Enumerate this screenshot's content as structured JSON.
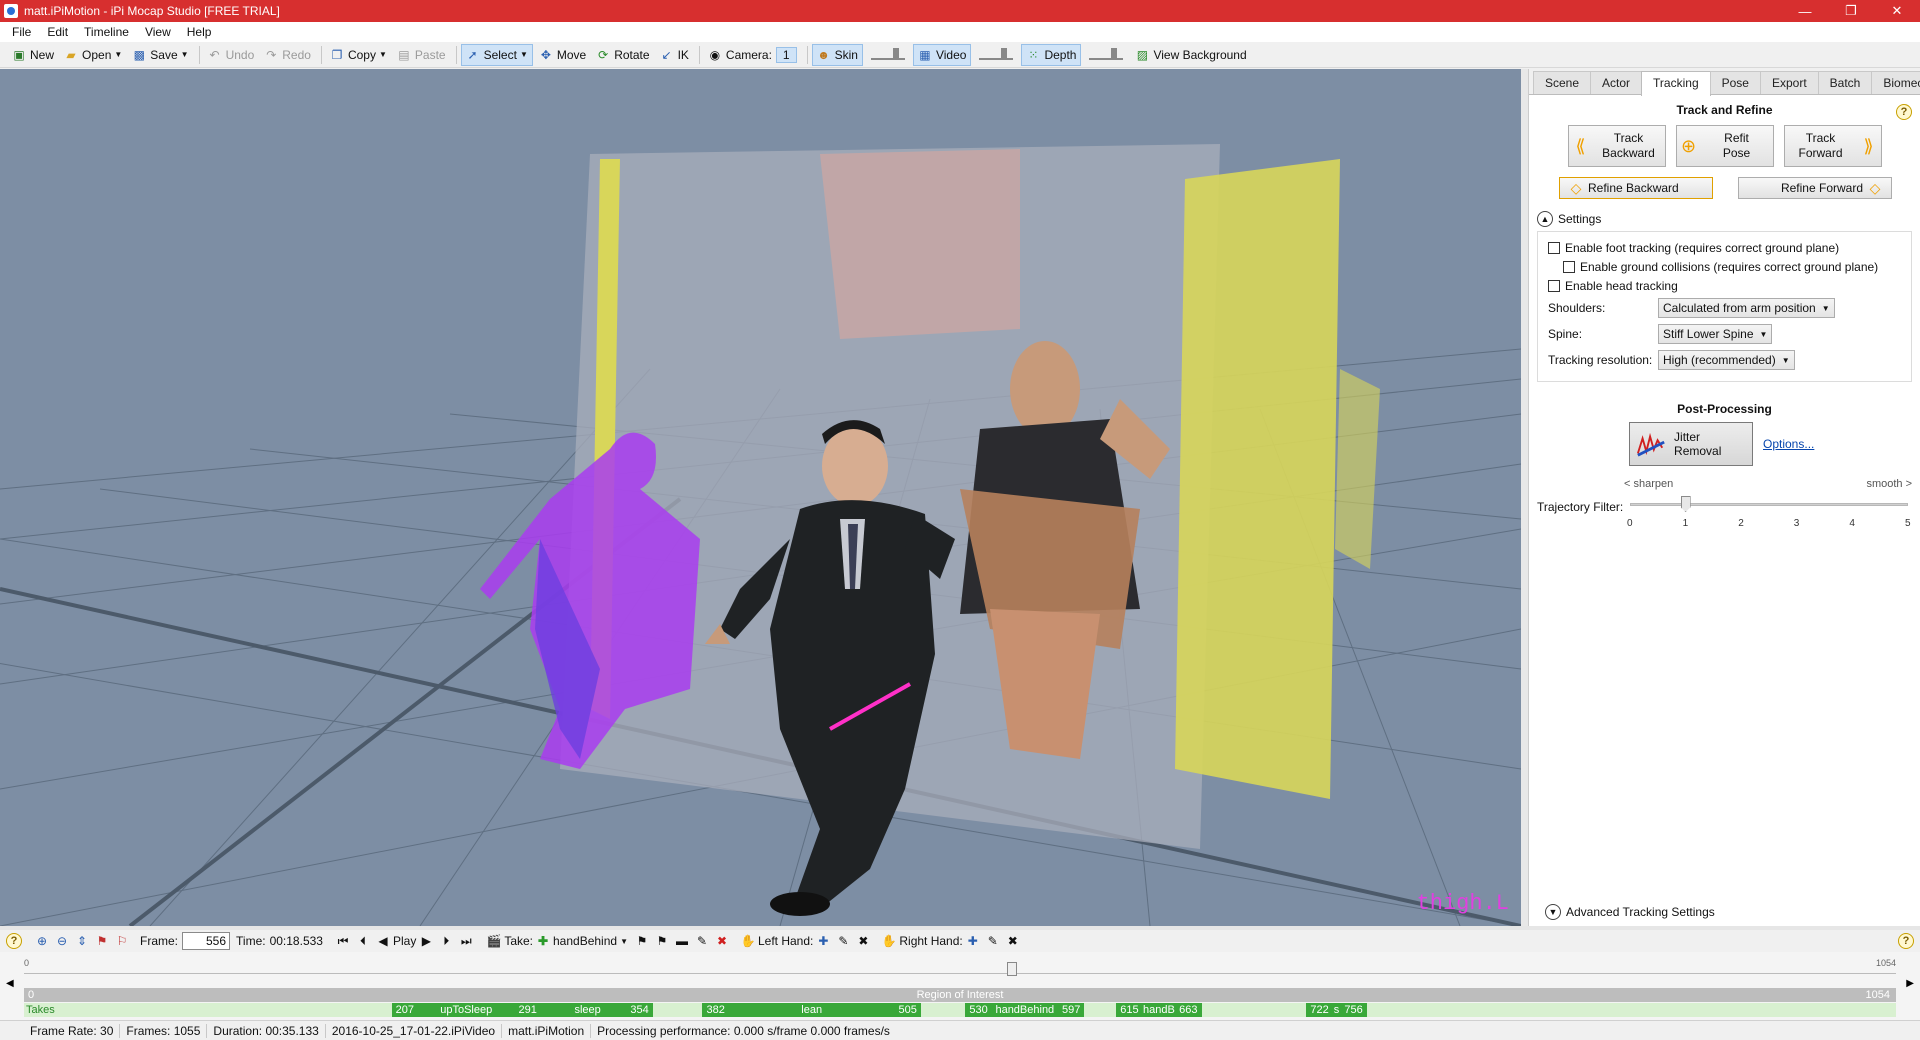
{
  "window": {
    "title": "matt.iPiMotion - iPi Mocap Studio [FREE TRIAL]",
    "minimize": "—",
    "maximize": "❐",
    "close": "✕"
  },
  "menu": [
    "File",
    "Edit",
    "Timeline",
    "View",
    "Help"
  ],
  "toolbar": {
    "new": "New",
    "open": "Open",
    "save": "Save",
    "undo": "Undo",
    "redo": "Redo",
    "copy": "Copy",
    "paste": "Paste",
    "select": "Select",
    "move": "Move",
    "rotate": "Rotate",
    "ik": "IK",
    "camera_label": "Camera:",
    "camera_value": "1",
    "skin": "Skin",
    "video": "Video",
    "depth": "Depth",
    "view_background": "View Background"
  },
  "viewport": {
    "bone_label": "thigh.L",
    "colors": {
      "background": "#7d8ea4",
      "grid": "#5f6f82",
      "backwall": "#9aa6b8",
      "yellow": "#d8d65a",
      "magenta": "#a93cf0"
    }
  },
  "panel": {
    "tabs": [
      "Scene",
      "Actor",
      "Tracking",
      "Pose",
      "Export",
      "Batch",
      "Biomech"
    ],
    "selected_tab": "Tracking",
    "help": "?",
    "track_refine_title": "Track and Refine",
    "track_backward": [
      "Track",
      "Backward"
    ],
    "refit_pose": [
      "Refit",
      "Pose"
    ],
    "track_forward": [
      "Track",
      "Forward"
    ],
    "refine_backward": "Refine Backward",
    "refine_forward": "Refine Forward",
    "settings_title": "Settings",
    "settings": {
      "foot_tracking": "Enable foot tracking (requires correct ground plane)",
      "ground_collisions": "Enable ground collisions (requires correct ground plane)",
      "head_tracking": "Enable head tracking",
      "shoulders_label": "Shoulders:",
      "shoulders_value": "Calculated from arm position",
      "spine_label": "Spine:",
      "spine_value": "Stiff Lower Spine",
      "resolution_label": "Tracking resolution:",
      "resolution_value": "High (recommended)"
    },
    "post_processing_title": "Post-Processing",
    "jitter_removal": "Jitter Removal",
    "options_link": "Options...",
    "sharpen": "< sharpen",
    "smooth": "smooth >",
    "trajectory_filter_label": "Trajectory Filter:",
    "trajectory_filter_value": 1,
    "trajectory_ticks": [
      "0",
      "1",
      "2",
      "3",
      "4",
      "5"
    ],
    "advanced": "Advanced Tracking Settings"
  },
  "timeline_bar": {
    "help": "?",
    "frame_label": "Frame:",
    "frame_value": "556",
    "time_label": "Time:",
    "time_value": "00:18.533",
    "play": "Play",
    "take_label": "Take:",
    "take_value": "handBehind",
    "left_hand": "Left Hand:",
    "right_hand": "Right Hand:"
  },
  "timeline": {
    "start": "0",
    "end": "1054",
    "current_frame": 556,
    "roi_label": "Region of Interest",
    "roi_start": "0",
    "roi_end": "1054",
    "takes_label": "Takes",
    "takes": [
      {
        "start": "207",
        "name": "upToSleep",
        "end": "291",
        "from": 207,
        "to": 291
      },
      {
        "start": "",
        "name": "sleep",
        "end": "354",
        "from": 291,
        "to": 354
      },
      {
        "start": "382",
        "name": "lean",
        "end": "505",
        "from": 382,
        "to": 505
      },
      {
        "start": "530",
        "name": "handBehind",
        "end": "597",
        "from": 530,
        "to": 597
      },
      {
        "start": "615",
        "name": "handB",
        "end": "663",
        "from": 615,
        "to": 663
      },
      {
        "start": "722",
        "name": "s",
        "end": "756",
        "from": 722,
        "to": 756
      }
    ]
  },
  "status": {
    "frame_rate": "Frame Rate: 30",
    "frames": "Frames: 1055",
    "duration": "Duration: 00:35.133",
    "video_file": "2016-10-25_17-01-22.iPiVideo",
    "project_file": "matt.iPiMotion",
    "performance": "Processing performance: 0.000 s/frame 0.000 frames/s"
  }
}
